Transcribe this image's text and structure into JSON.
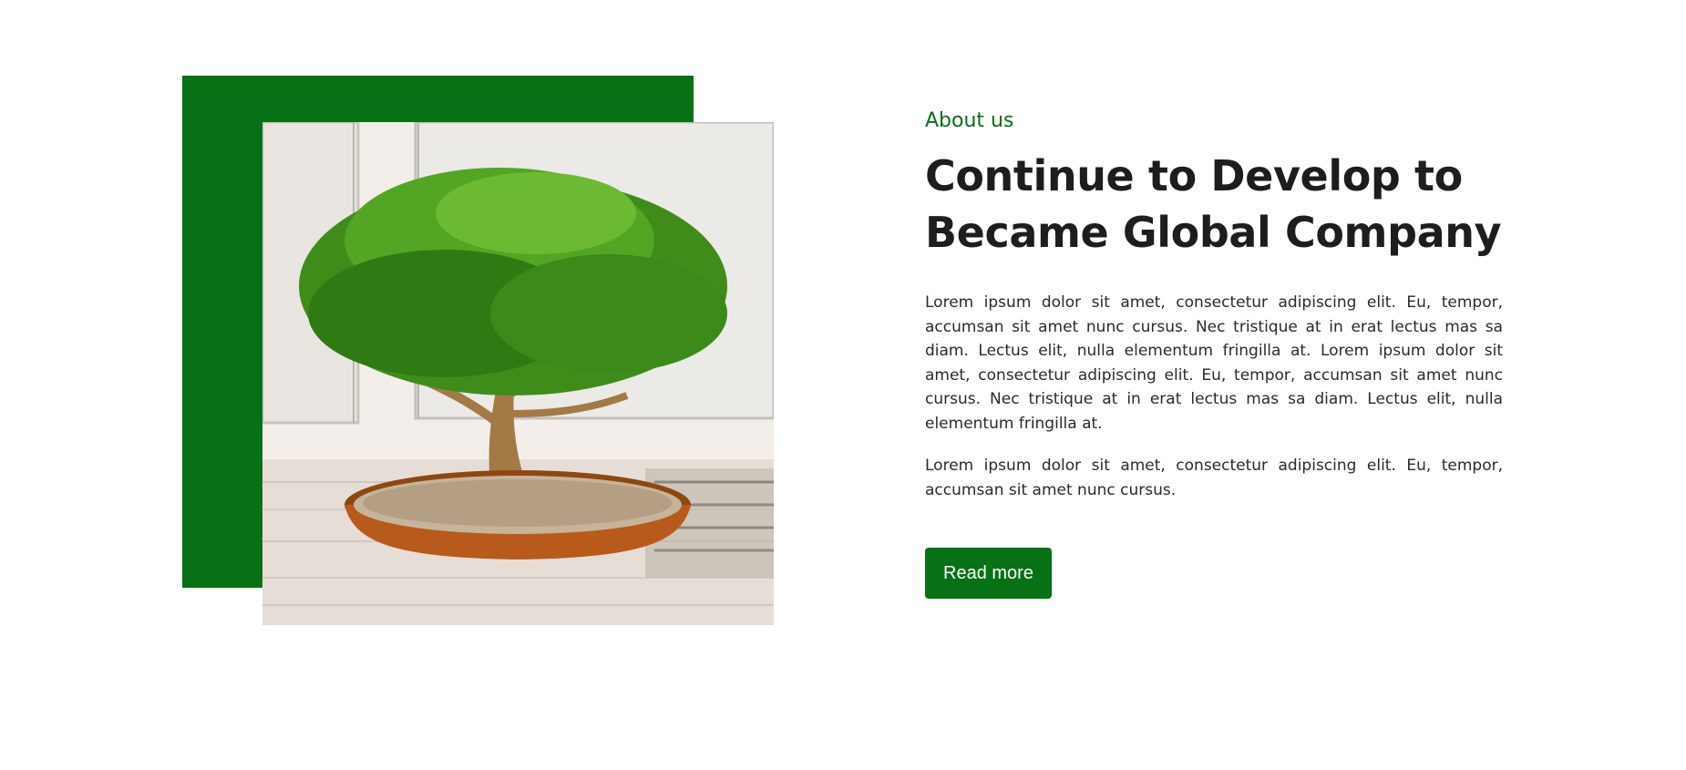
{
  "about": {
    "eyebrow": "About us",
    "title_line1": "Continue to Develop to",
    "title_line2": "Became Global Company",
    "paragraph1": "Lorem ipsum dolor sit amet, consectetur adipiscing elit. Eu, tempor, accumsan sit amet nunc cursus. Nec tristique at in erat lectus mas sa diam. Lectus elit, nulla elementum fringilla at. Lorem ipsum dolor sit amet, consectetur adipiscing elit. Eu, tempor, accumsan sit amet nunc cursus. Nec tristique at in erat lectus mas sa diam. Lectus elit, nulla elementum fringilla at.",
    "paragraph2": "Lorem ipsum dolor sit amet, consectetur adipiscing elit. Eu, tempor, accumsan sit amet nunc cursus.",
    "button_label": "Read more"
  },
  "colors": {
    "accent": "#087015",
    "text": "#1d1d1d",
    "background": "#ffffff"
  },
  "image": {
    "subject": "bonsai-tree-photo"
  }
}
